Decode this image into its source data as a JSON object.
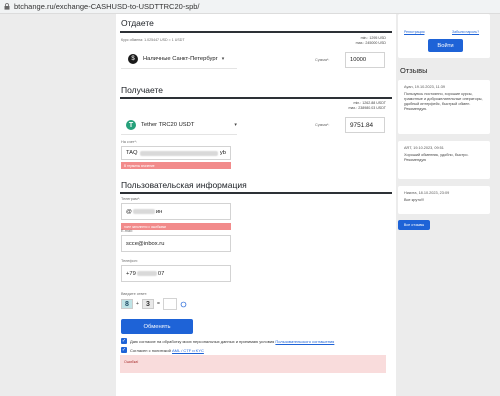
{
  "browser": {
    "url": "btchange.ru/exchange-CASHUSD-to-USDTTRC20-spb/"
  },
  "give": {
    "title": "Отдаете",
    "rate": "Курс обмена: 1.025447 USD = 1 USDT",
    "min": "min.: 1295 USD",
    "max": "max.: 245000 USD",
    "currency": "Наличные Санкт-Петербург",
    "amount_label": "Сумма*:",
    "amount": "10000"
  },
  "get": {
    "title": "Получаете",
    "reserve_min": "min.: 1262.88 USDT",
    "reserve_max": "max.: 238980.03 USDT",
    "currency": "Tether TRC20 USDT",
    "amount_label": "Сумма*:",
    "amount": "9751.84",
    "account_label": "На счет*:",
    "account_prefix": "TAQ",
    "account_suffix": "yb",
    "account_error": "В термины значение"
  },
  "personal": {
    "title": "Пользовательская информация",
    "telegram_label": "Телеграм*:",
    "telegram_prefix": "@",
    "telegram_suffix": "ин",
    "telegram_error": "поле заполнено с ошибками",
    "email_label": "E-mail:",
    "email": "scce@inbox.ru",
    "phone_label": "Телефон:",
    "phone_prefix": "+79",
    "phone_suffix": "07"
  },
  "captcha": {
    "label": "Введите ответ:",
    "digit1": "8",
    "digit2": "3",
    "operator": "+",
    "equals": "="
  },
  "submit_label": "Обменять",
  "agree1_text": "Даю согласие на обработку моих персональных данных и принимаю условия",
  "agree1_link": "Пользовательского соглашения",
  "agree2_text": "Согласен с политикой",
  "agree2_link": "AML / CTF и KYC",
  "alert_text": "Ошибка!",
  "sidebar": {
    "register_link": "Регистрация",
    "forgot_link": "Забыли пароль?",
    "login_button": "Войти",
    "reviews_title": "Отзывы",
    "reviews": [
      {
        "author": "Ayan, 19.10.2023, 11:39",
        "text": "Пользуюсь постоянно, хорошие курсы, грамотные и доброжелательные операторы, удобный интерфейс, быстрый обмен. Рекомендую."
      },
      {
        "author": "ART, 19.10.2023, 09:51",
        "text": "Хороший обменник, удобно, быстро. Рекомендую"
      },
      {
        "author": "Никита, 18.10.2023, 23:09",
        "text": "Все круто!!!"
      }
    ],
    "all_reviews": "Все отзывы"
  }
}
